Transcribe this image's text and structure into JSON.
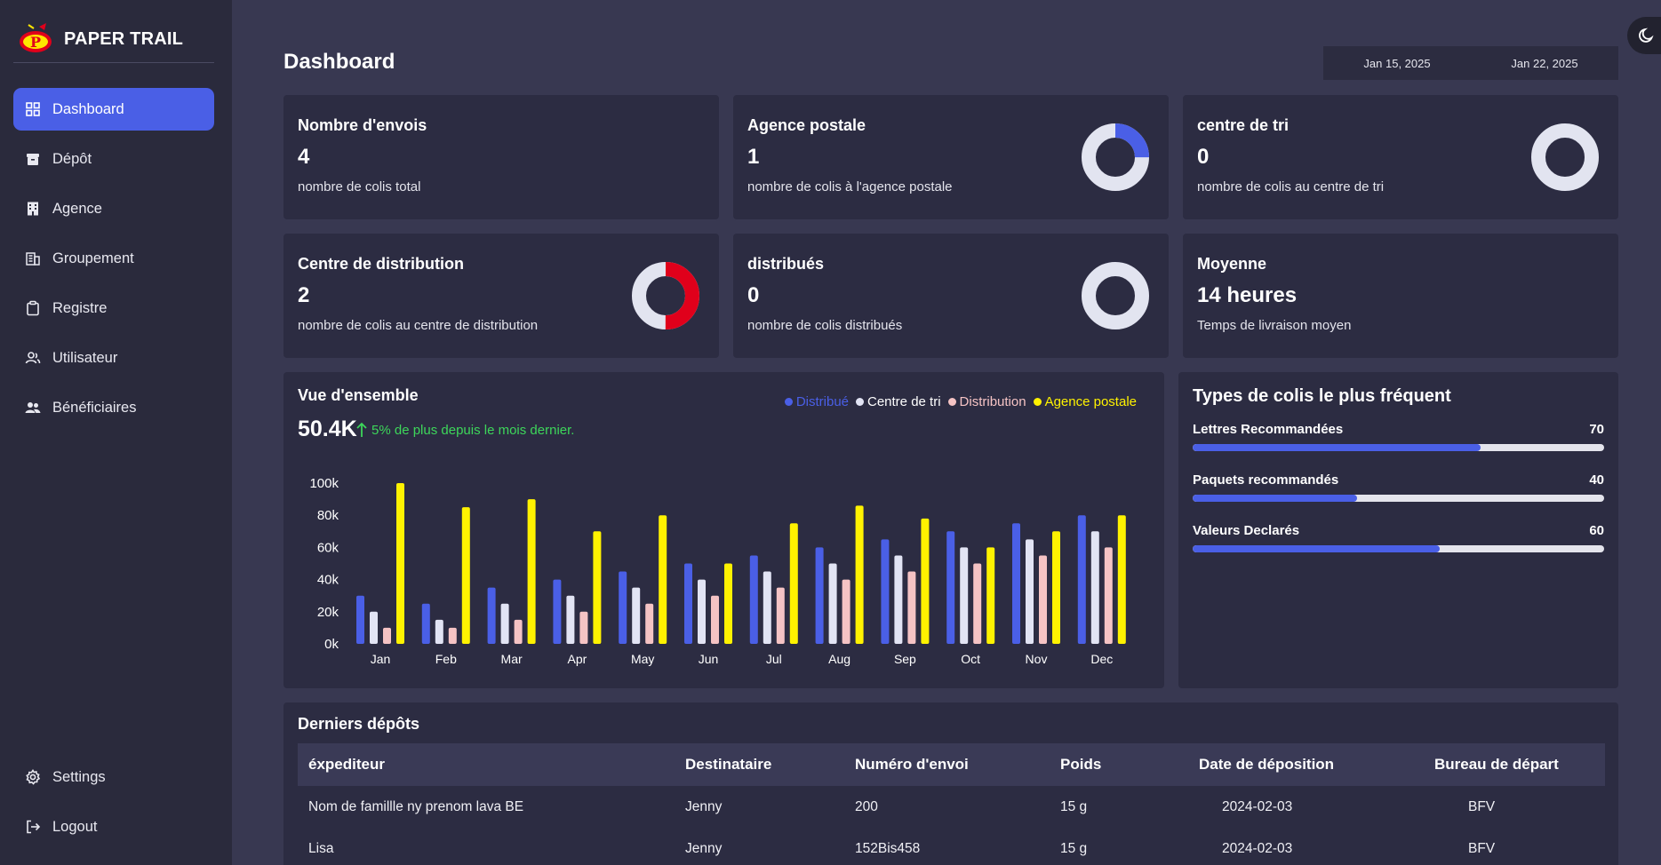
{
  "brand": {
    "name": "PAPER TRAIL"
  },
  "sidebar": {
    "items": [
      {
        "label": "Dashboard",
        "icon": "dashboard-icon",
        "active": true
      },
      {
        "label": "Dépôt",
        "icon": "archive-box-icon"
      },
      {
        "label": "Agence",
        "icon": "building-icon"
      },
      {
        "label": "Groupement",
        "icon": "office-icon"
      },
      {
        "label": "Registre",
        "icon": "clipboard-icon"
      },
      {
        "label": "Utilisateur",
        "icon": "user-icon"
      },
      {
        "label": "Bénéficiaires",
        "icon": "users-icon"
      }
    ],
    "bottom": [
      {
        "label": "Settings",
        "icon": "gear-icon"
      },
      {
        "label": "Logout",
        "icon": "logout-icon"
      }
    ]
  },
  "header": {
    "title": "Dashboard",
    "date_start": "Jan 15, 2025",
    "date_end": "Jan 22, 2025"
  },
  "stats": [
    {
      "title": "Nombre d'envois",
      "value": "4",
      "sub": "nombre de colis total"
    },
    {
      "title": "Agence postale",
      "value": "1",
      "sub": "nombre de colis à l'agence postale",
      "donut_fraction": 0.25,
      "donut_color": "#4a5fe6"
    },
    {
      "title": "centre de tri",
      "value": "0",
      "sub": "nombre de colis au centre de tri",
      "donut_fraction": 0,
      "donut_color": "#4a5fe6"
    },
    {
      "title": "Centre de distribution",
      "value": "2",
      "sub": "nombre de colis au centre de distribution",
      "donut_fraction": 0.5,
      "donut_color": "#e0001b"
    },
    {
      "title": "distribués",
      "value": "0",
      "sub": "nombre de colis distribués",
      "donut_fraction": 0,
      "donut_color": "#4a5fe6"
    },
    {
      "title": "Moyenne",
      "value": "14 heures",
      "sub": "Temps de livraison moyen"
    }
  ],
  "overview": {
    "title": "Vue d'ensemble",
    "total": "50.4K",
    "growth": "5% de plus depuis le mois dernier."
  },
  "chart_data": {
    "type": "bar",
    "categories": [
      "Jan",
      "Feb",
      "Mar",
      "Apr",
      "May",
      "Jun",
      "Jul",
      "Aug",
      "Sep",
      "Oct",
      "Nov",
      "Dec"
    ],
    "series": [
      {
        "name": "Distribué",
        "color": "#4a5fe6",
        "values": [
          30,
          25,
          35,
          40,
          45,
          50,
          55,
          60,
          65,
          70,
          75,
          80
        ]
      },
      {
        "name": "Centre de tri",
        "color": "#e2e4f4",
        "values": [
          20,
          15,
          25,
          30,
          35,
          40,
          45,
          50,
          55,
          60,
          65,
          70
        ]
      },
      {
        "name": "Distribution",
        "color": "#f5c3c4",
        "values": [
          10,
          10,
          15,
          20,
          25,
          30,
          35,
          40,
          45,
          50,
          55,
          60
        ]
      },
      {
        "name": "Agence postale",
        "color": "#fff200",
        "values": [
          100,
          85,
          90,
          70,
          80,
          50,
          75,
          86,
          78,
          60,
          70,
          80
        ]
      }
    ],
    "yticks": [
      "0k",
      "20k",
      "40k",
      "60k",
      "80k",
      "100k"
    ],
    "ylim": [
      0,
      100
    ],
    "grid": false,
    "legend_position": "top-right"
  },
  "types": {
    "title": "Types de colis le plus fréquent",
    "items": [
      {
        "label": "Lettres Recommandées",
        "value": 70,
        "value_label": "70"
      },
      {
        "label": "Paquets recommandés",
        "value": 40,
        "value_label": "40"
      },
      {
        "label": "Valeurs Declarés",
        "value": 60,
        "value_label": "60"
      }
    ]
  },
  "recent": {
    "title": "Derniers dépôts",
    "columns": [
      "éxpediteur",
      "Destinataire",
      "Numéro d'envoi",
      "Poids",
      "Date de déposition",
      "Bureau de départ"
    ],
    "rows": [
      [
        "Nom de famillle ny prenom lava BE",
        "Jenny",
        "200",
        "15 g",
        "2024-02-03",
        "BFV"
      ],
      [
        "Lisa",
        "Jenny",
        "152Bis458",
        "15 g",
        "2024-02-03",
        "BFV"
      ]
    ]
  }
}
